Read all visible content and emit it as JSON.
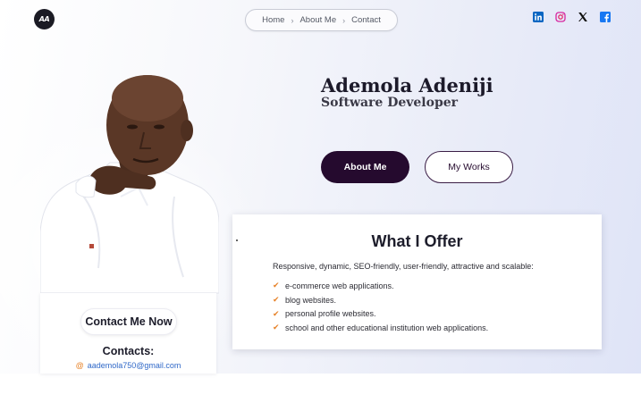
{
  "brand": {
    "logo_text": "AA"
  },
  "breadcrumb": [
    {
      "label": "Home"
    },
    {
      "label": "About Me"
    },
    {
      "label": "Contact"
    }
  ],
  "breadcrumb_sep": "›",
  "social": [
    {
      "icon": "linkedin-icon",
      "color": "#0a66c2"
    },
    {
      "icon": "instagram-icon",
      "color": "#d6249f"
    },
    {
      "icon": "x-icon",
      "color": "#111111"
    },
    {
      "icon": "facebook-icon",
      "color": "#1877f2"
    }
  ],
  "hero": {
    "name": "Ademola Adeniji",
    "role": "Software Developer",
    "about_btn": "About Me",
    "works_btn": "My Works"
  },
  "offer": {
    "title": "What I Offer",
    "intro": "Responsive, dynamic, SEO-friendly, user-friendly, attractive and scalable:",
    "items": [
      "e-commerce web applications.",
      "blog websites.",
      "personal profile websites.",
      "school and other educational institution web applications."
    ],
    "check": "✔"
  },
  "contact": {
    "button": "Contact Me Now",
    "title": "Contacts:",
    "email_icon": "@",
    "email": "aademola750@gmail.com"
  },
  "colors": {
    "primary": "#250a2e",
    "accent": "#e7832a",
    "link": "#2f68c8"
  }
}
